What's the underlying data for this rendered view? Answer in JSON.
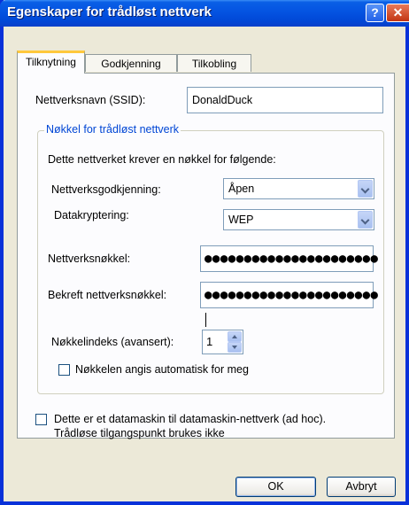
{
  "window": {
    "title": "Egenskaper for trådløst nettverk",
    "help_symbol": "?",
    "close_symbol": "✕"
  },
  "tabs": [
    {
      "label": "Tilknytning",
      "active": true
    },
    {
      "label": "Godkjenning",
      "active": false
    },
    {
      "label": "Tilkobling",
      "active": false
    }
  ],
  "form": {
    "ssid_label": "Nettverksnavn (SSID):",
    "ssid_value": "DonaldDuck",
    "group_title": "Nøkkel for trådløst nettverk",
    "requires_text": "Dette nettverket krever en nøkkel for følgende:",
    "auth_label": "Nettverksgodkjenning:",
    "auth_value": "Åpen",
    "encryption_label": "Datakryptering:",
    "encryption_value": "WEP",
    "key_label": "Nettverksnøkkel:",
    "key_value": "●●●●●●●●●●●●●●●●●●●●●●",
    "confirm_label": "Bekreft nettverksnøkkel:",
    "confirm_value": "●●●●●●●●●●●●●●●●●●●●●●",
    "index_label": "Nøkkelindeks (avansert):",
    "index_value": "1",
    "auto_key_label": "Nøkkelen angis automatisk for meg",
    "auto_key_checked": false,
    "adhoc_label_line1": "Dette er et datamaskin til datamaskin-nettverk (ad hoc).",
    "adhoc_label_line2": "Trådløse tilgangspunkt brukes ikke",
    "adhoc_checked": false
  },
  "buttons": {
    "ok": "OK",
    "cancel": "Avbryt"
  }
}
